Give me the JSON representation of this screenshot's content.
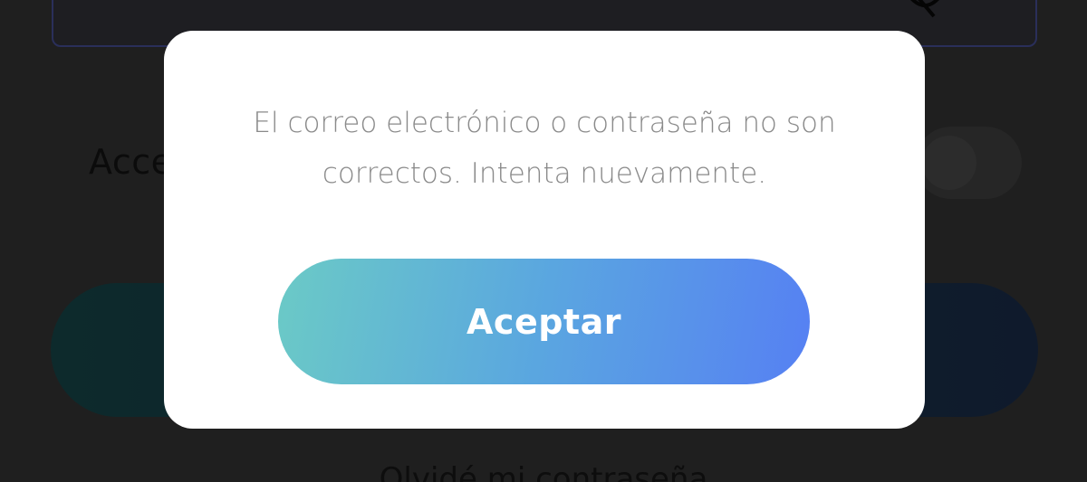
{
  "background": {
    "remember_label": "Acce",
    "forgot_password_link": "Olvidé mi contraseña",
    "icons": {
      "password_toggle": "eye-off-icon"
    }
  },
  "dialog": {
    "message": "El correo electrónico o contraseña no son correctos. Intenta nuevamente.",
    "accept_label": "Aceptar"
  },
  "colors": {
    "overlay_bg": "#1f1f1f",
    "dialog_bg": "#ffffff",
    "message_text": "#8a8a8a",
    "button_gradient_start": "#6bcac6",
    "button_gradient_end": "#5680f3"
  }
}
